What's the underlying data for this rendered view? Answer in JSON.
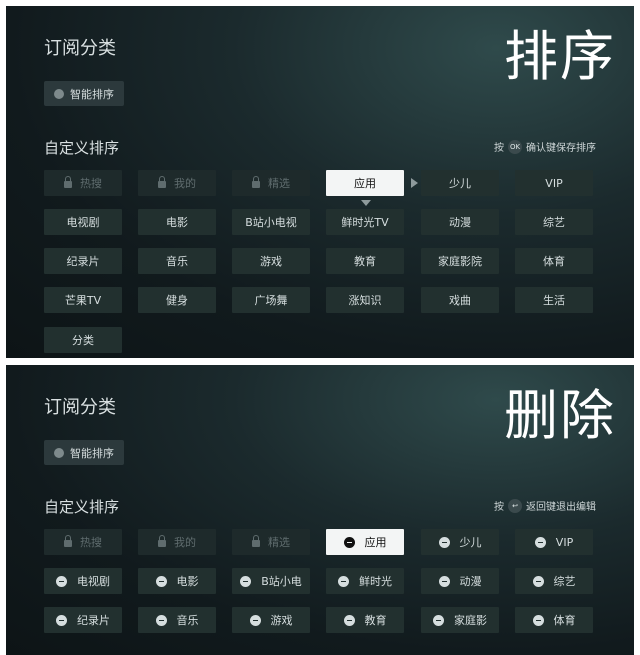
{
  "panel1": {
    "title": "订阅分类",
    "big_label": "排序",
    "smart_sort": "智能排序",
    "section": "自定义排序",
    "hint_prefix": "按",
    "hint_key": "OK",
    "hint_suffix": "确认键保存排序",
    "locked": [
      "热搜",
      "我的",
      "精选"
    ],
    "selected": "应用",
    "rows": [
      [
        "少儿",
        "VIP"
      ],
      [
        "电视剧",
        "电影",
        "B站小电视",
        "鲜时光TV",
        "动漫",
        "综艺"
      ],
      [
        "纪录片",
        "音乐",
        "游戏",
        "教育",
        "家庭影院",
        "体育"
      ],
      [
        "芒果TV",
        "健身",
        "广场舞",
        "涨知识",
        "戏曲",
        "生活"
      ],
      [
        "分类"
      ]
    ]
  },
  "panel2": {
    "title": "订阅分类",
    "big_label": "删除",
    "smart_sort": "智能排序",
    "section": "自定义排序",
    "hint_prefix": "按",
    "hint_key": "↩",
    "hint_suffix": "返回键退出编辑",
    "locked": [
      "热搜",
      "我的",
      "精选"
    ],
    "selected": "应用",
    "rows": [
      [
        "少儿",
        "VIP"
      ],
      [
        "电视剧",
        "电影",
        "B站小电",
        "鲜时光",
        "动漫",
        "综艺"
      ],
      [
        "纪录片",
        "音乐",
        "游戏",
        "教育",
        "家庭影",
        "体育"
      ]
    ]
  }
}
